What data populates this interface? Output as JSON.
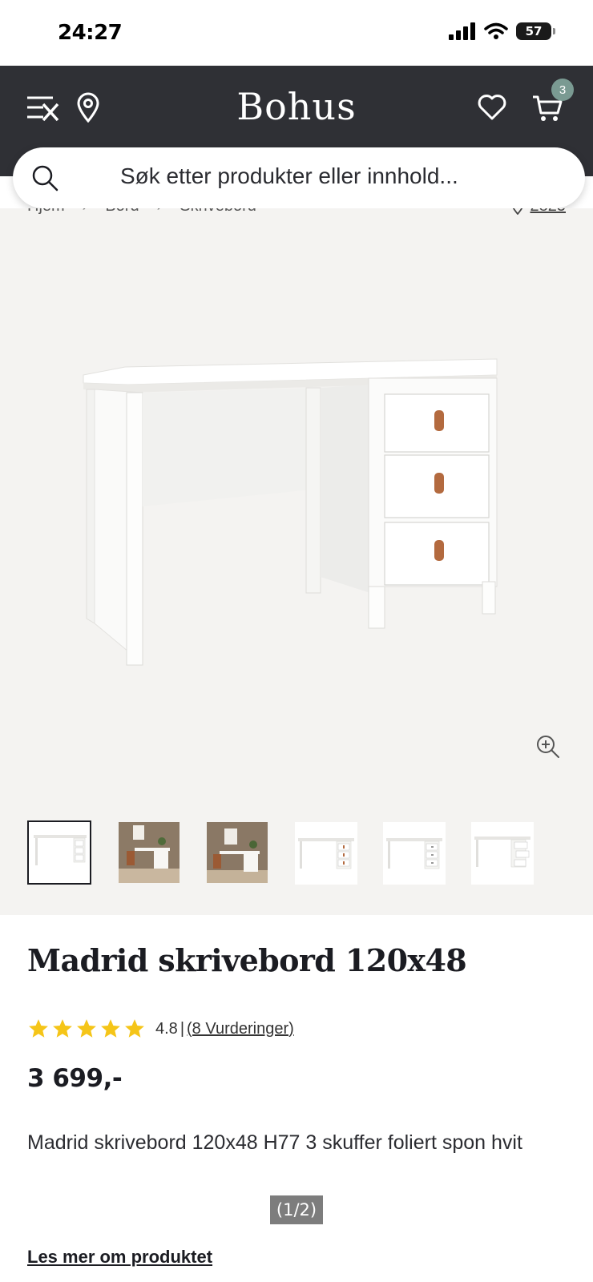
{
  "status_bar": {
    "time": "24:27",
    "battery": "57",
    "icons": [
      "signal-icon",
      "wifi-icon",
      "battery-icon"
    ]
  },
  "header": {
    "logo": "Bohus",
    "cart_count": "3",
    "icons": [
      "menu-icon",
      "location-pin-icon",
      "heart-icon",
      "cart-icon"
    ]
  },
  "search": {
    "placeholder": "Søk etter produkter eller innhold..."
  },
  "breadcrumb": {
    "items": [
      "Hjem",
      "Bord",
      "Skrivebord"
    ],
    "postcode": "2825"
  },
  "gallery": {
    "thumbnail_count": 6,
    "active_index": 0
  },
  "product": {
    "title": "Madrid skrivebord 120x48",
    "rating": "4.8",
    "rating_separator": "|",
    "reviews_link": "(8 Vurderinger)",
    "stars": 5,
    "price": "3 699,-",
    "description": "Madrid skrivebord 120x48 H77 3 skuffer foliert spon hvit",
    "page_indicator": "(1/2)",
    "read_more": "Les mer om produktet"
  },
  "colors": {
    "header_bg": "#2f3035",
    "star": "#f5c518",
    "gallery_bg": "#f4f3f1",
    "badge": "#7a9a92",
    "text": "#1b1c22"
  }
}
